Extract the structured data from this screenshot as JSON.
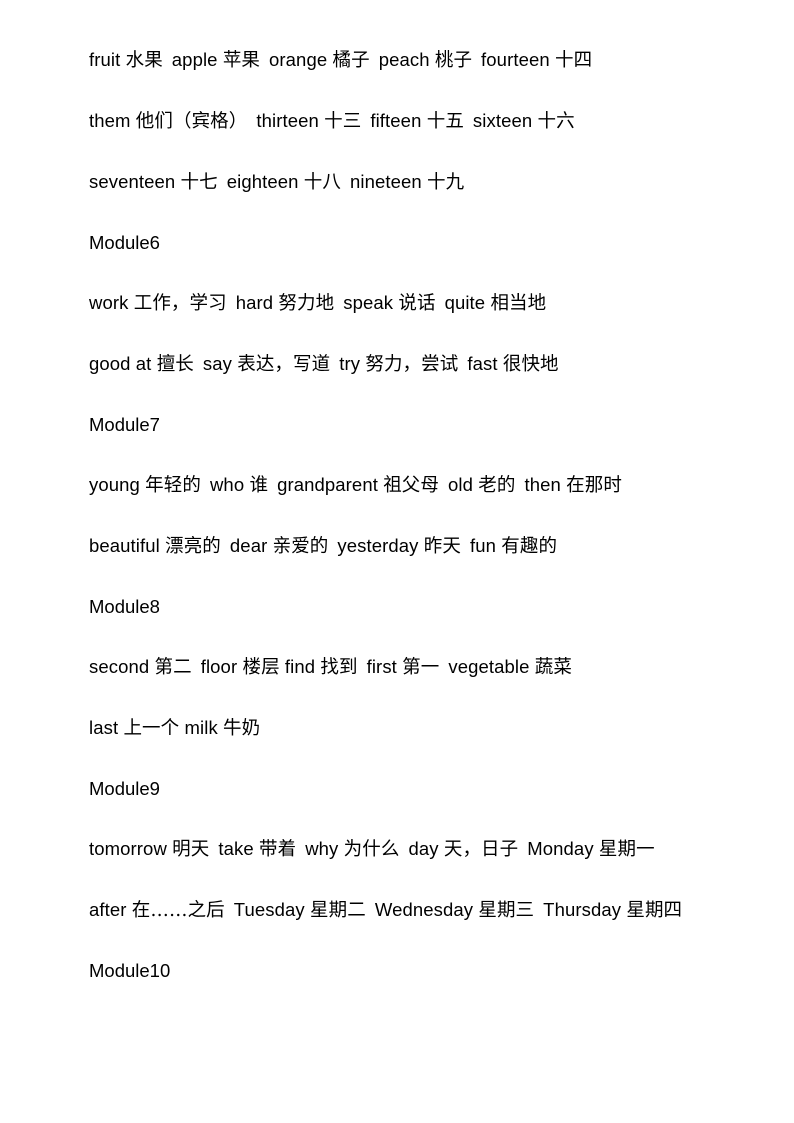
{
  "document": {
    "type": "vocabulary-worksheet",
    "language_pair": "English-Chinese",
    "background_color": "#ffffff",
    "text_color": "#000000"
  },
  "lines": [
    {
      "id": "line-1",
      "kind": "vocab",
      "indent": true,
      "text": "fruit 水果  apple 苹果  orange 橘子  peach 桃子  fourteen 十四",
      "entries": [
        {
          "en": "fruit",
          "zh": "水果"
        },
        {
          "en": "apple",
          "zh": "苹果"
        },
        {
          "en": "orange",
          "zh": "橘子"
        },
        {
          "en": "peach",
          "zh": "桃子"
        },
        {
          "en": "fourteen",
          "zh": "十四"
        }
      ]
    },
    {
      "id": "line-2",
      "kind": "vocab",
      "indent": true,
      "text": "them 他们（宾格）  thirteen 十三  fifteen 十五  sixteen 十六",
      "entries": [
        {
          "en": "them",
          "zh": "他们（宾格）"
        },
        {
          "en": "thirteen",
          "zh": "十三"
        },
        {
          "en": "fifteen",
          "zh": "十五"
        },
        {
          "en": "sixteen",
          "zh": "十六"
        }
      ]
    },
    {
      "id": "line-3",
      "kind": "vocab",
      "indent": true,
      "text": "seventeen 十七  eighteen 十八  nineteen 十九",
      "entries": [
        {
          "en": "seventeen",
          "zh": "十七"
        },
        {
          "en": "eighteen",
          "zh": "十八"
        },
        {
          "en": "nineteen",
          "zh": "十九"
        }
      ]
    },
    {
      "id": "heading-module6",
      "kind": "heading",
      "indent": true,
      "text": "Module6"
    },
    {
      "id": "line-4",
      "kind": "vocab",
      "indent": true,
      "text": "work 工作，学习  hard 努力地  speak 说话  quite 相当地",
      "entries": [
        {
          "en": "work",
          "zh": "工作，学习"
        },
        {
          "en": "hard",
          "zh": "努力地"
        },
        {
          "en": "speak",
          "zh": "说话"
        },
        {
          "en": "quite",
          "zh": "相当地"
        }
      ]
    },
    {
      "id": "line-5",
      "kind": "vocab",
      "indent": true,
      "text": "good at 擅长  say 表达，写道  try 努力，尝试  fast 很快地",
      "entries": [
        {
          "en": "good at",
          "zh": "擅长"
        },
        {
          "en": "say",
          "zh": "表达，写道"
        },
        {
          "en": "try",
          "zh": "努力，尝试"
        },
        {
          "en": "fast",
          "zh": "很快地"
        }
      ]
    },
    {
      "id": "heading-module7",
      "kind": "heading",
      "indent": true,
      "text": "Module7"
    },
    {
      "id": "line-6",
      "kind": "vocab",
      "indent": true,
      "text": "young 年轻的  who 谁  grandparent 祖父母  old 老的  then 在那时",
      "entries": [
        {
          "en": "young",
          "zh": "年轻的"
        },
        {
          "en": "who",
          "zh": "谁"
        },
        {
          "en": "grandparent",
          "zh": "祖父母"
        },
        {
          "en": "old",
          "zh": "老的"
        },
        {
          "en": "then",
          "zh": "在那时"
        }
      ]
    },
    {
      "id": "line-7",
      "kind": "vocab",
      "indent": true,
      "text": "beautiful 漂亮的  dear 亲爱的  yesterday 昨天  fun 有趣的",
      "entries": [
        {
          "en": "beautiful",
          "zh": "漂亮的"
        },
        {
          "en": "dear",
          "zh": "亲爱的"
        },
        {
          "en": "yesterday",
          "zh": "昨天"
        },
        {
          "en": "fun",
          "zh": "有趣的"
        }
      ]
    },
    {
      "id": "heading-module8",
      "kind": "heading",
      "indent": true,
      "text": "Module8"
    },
    {
      "id": "line-8",
      "kind": "vocab",
      "indent": true,
      "text": "second 第二  floor 楼层 find 找到  first 第一  vegetable 蔬菜",
      "entries": [
        {
          "en": "second",
          "zh": "第二"
        },
        {
          "en": "floor",
          "zh": "楼层"
        },
        {
          "en": "find",
          "zh": "找到"
        },
        {
          "en": "first",
          "zh": "第一"
        },
        {
          "en": "vegetable",
          "zh": "蔬菜"
        }
      ]
    },
    {
      "id": "line-9",
      "kind": "vocab",
      "indent": true,
      "text": "last 上一个 milk 牛奶",
      "entries": [
        {
          "en": "last",
          "zh": "上一个"
        },
        {
          "en": "milk",
          "zh": "牛奶"
        }
      ]
    },
    {
      "id": "heading-module9",
      "kind": "heading",
      "indent": true,
      "text": "Module9"
    },
    {
      "id": "line-10",
      "kind": "vocab",
      "indent": true,
      "text": "tomorrow 明天  take 带着  why 为什么  day 天，日子  Monday 星期一",
      "entries": [
        {
          "en": "tomorrow",
          "zh": "明天"
        },
        {
          "en": "take",
          "zh": "带着"
        },
        {
          "en": "why",
          "zh": "为什么"
        },
        {
          "en": "day",
          "zh": "天，日子"
        },
        {
          "en": "Monday",
          "zh": "星期一"
        }
      ]
    },
    {
      "id": "line-11",
      "kind": "vocab",
      "indent": true,
      "text": "after 在……之后  Tuesday 星期二  Wednesday 星期三  Thursday 星期四",
      "entries": [
        {
          "en": "after",
          "zh": "在……之后"
        },
        {
          "en": "Tuesday",
          "zh": "星期二"
        },
        {
          "en": "Wednesday",
          "zh": "星期三"
        },
        {
          "en": "Thursday",
          "zh": "星期四"
        }
      ]
    },
    {
      "id": "heading-module10",
      "kind": "heading",
      "indent": true,
      "text": "Module10"
    }
  ]
}
